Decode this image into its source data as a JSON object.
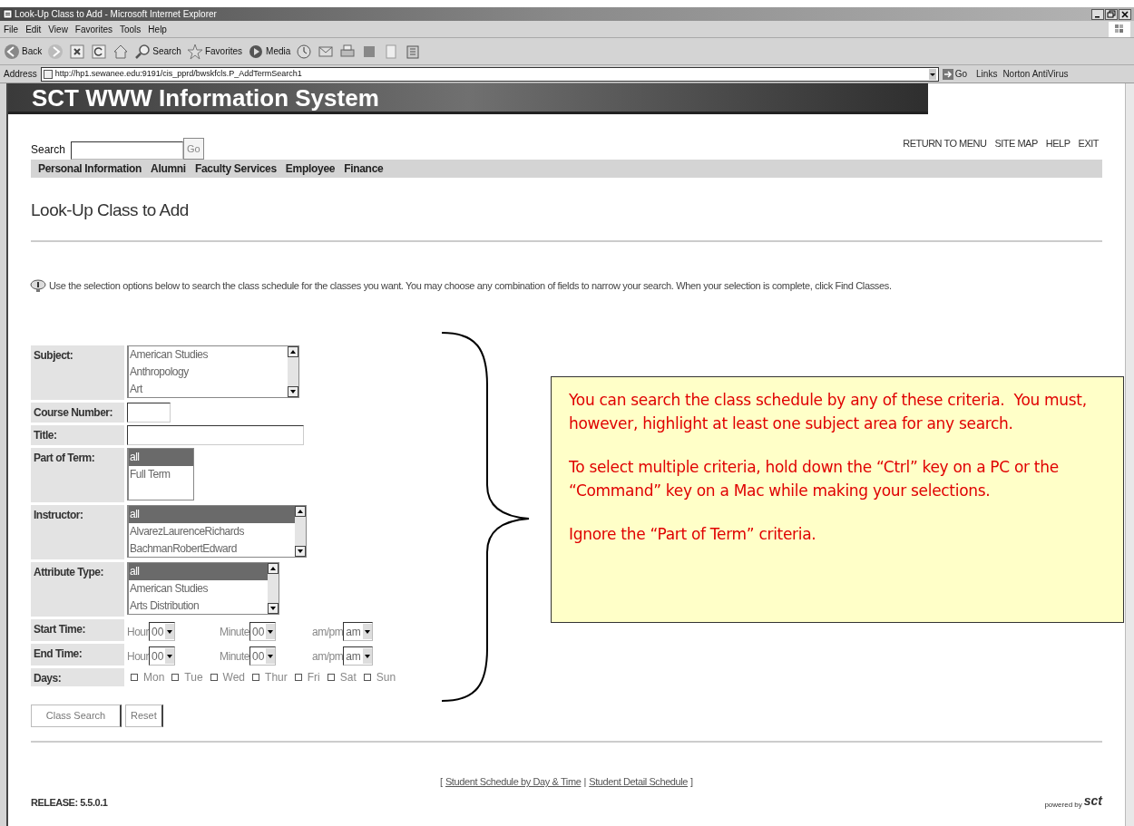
{
  "window": {
    "title": "Look-Up Class to Add - Microsoft Internet Explorer"
  },
  "menu": [
    "File",
    "Edit",
    "View",
    "Favorites",
    "Tools",
    "Help"
  ],
  "toolbar": [
    {
      "kind": "back",
      "label": "Back"
    },
    {
      "kind": "forward"
    },
    {
      "kind": "stop"
    },
    {
      "kind": "refresh"
    },
    {
      "kind": "home"
    },
    {
      "kind": "search",
      "label": "Search"
    },
    {
      "kind": "favorites",
      "label": "Favorites"
    },
    {
      "kind": "media",
      "label": "Media"
    },
    {
      "kind": "history"
    },
    {
      "kind": "mail"
    },
    {
      "kind": "print"
    },
    {
      "kind": "edit"
    },
    {
      "kind": "discuss"
    },
    {
      "kind": "messenger"
    }
  ],
  "address_bar": {
    "label": "Address",
    "url": "http://hp1.sewanee.edu:9191/cis_pprd/bwskfcls.P_AddTermSearch1",
    "go": "Go",
    "links": "Links",
    "toolbar_item": "Norton AntiVirus"
  },
  "page": {
    "banner": "SCT WWW Information System",
    "search": {
      "label": "Search",
      "button": "Go"
    },
    "top_links": [
      "RETURN TO MENU",
      "SITE MAP",
      "HELP",
      "EXIT"
    ],
    "nav": [
      "Personal Information",
      "Alumni",
      "Faculty Services",
      "Employee",
      "Finance"
    ],
    "heading": "Look-Up Class to Add",
    "info": "Use the selection options below to search the class schedule for the classes you want. You may choose any combination of fields to narrow your search. When your selection is complete, click Find Classes.",
    "fields": [
      {
        "kind": "listbox",
        "label": "Subject:",
        "options": [
          {
            "text": "American Studies",
            "selected": false
          },
          {
            "text": "Anthropology",
            "selected": false
          },
          {
            "text": "Art",
            "selected": false
          }
        ]
      },
      {
        "kind": "text",
        "label": "Course Number:"
      },
      {
        "kind": "text",
        "label": "Title:"
      },
      {
        "kind": "listbox",
        "label": "Part of Term:",
        "options": [
          {
            "text": "all",
            "selected": true
          },
          {
            "text": "Full Term",
            "selected": false
          }
        ]
      },
      {
        "kind": "listbox",
        "label": "Instructor:",
        "options": [
          {
            "text": "all",
            "selected": true
          },
          {
            "text": "AlvarezLaurenceRichards",
            "selected": false
          },
          {
            "text": "BachmanRobertEdward",
            "selected": false
          }
        ]
      },
      {
        "kind": "listbox",
        "label": "Attribute Type:",
        "options": [
          {
            "text": "all",
            "selected": true
          },
          {
            "text": "American Studies",
            "selected": false
          },
          {
            "text": "Arts Distribution",
            "selected": false
          }
        ]
      },
      {
        "kind": "time",
        "label": "Start Time:",
        "parts": [
          {
            "label": "Hour",
            "value": "00"
          },
          {
            "label": "Minute",
            "value": "00"
          },
          {
            "label": "am/pm",
            "value": "am"
          }
        ]
      },
      {
        "kind": "time",
        "label": "End Time:",
        "parts": [
          {
            "label": "Hour",
            "value": "00"
          },
          {
            "label": "Minute",
            "value": "00"
          },
          {
            "label": "am/pm",
            "value": "am"
          }
        ]
      },
      {
        "kind": "days",
        "label": "Days:",
        "days": [
          {
            "text": "Mon",
            "checked": false
          },
          {
            "text": "Tue",
            "checked": false
          },
          {
            "text": "Wed",
            "checked": false
          },
          {
            "text": "Thur",
            "checked": false
          },
          {
            "text": "Fri",
            "checked": false
          },
          {
            "text": "Sat",
            "checked": false
          },
          {
            "text": "Sun",
            "checked": false
          }
        ]
      }
    ],
    "buttons": [
      "Class Search",
      "Reset"
    ],
    "footer_open": "[",
    "footer_links": [
      "Student Schedule by Day & Time",
      "Student Detail Schedule"
    ],
    "footer_separator": "|",
    "footer_close": "]",
    "release": "RELEASE: 5.5.0.1",
    "powered_by": "powered by",
    "logo": "sct"
  },
  "callout": {
    "paragraphs": [
      "You can search the class schedule by any of these criteria.  You must, however, highlight at least one subject area for any search.",
      "To select multiple criteria, hold down the “Ctrl” key on a PC or the “Command” key on a Mac while making your selections.",
      "Ignore the “Part of Term” criteria."
    ]
  }
}
